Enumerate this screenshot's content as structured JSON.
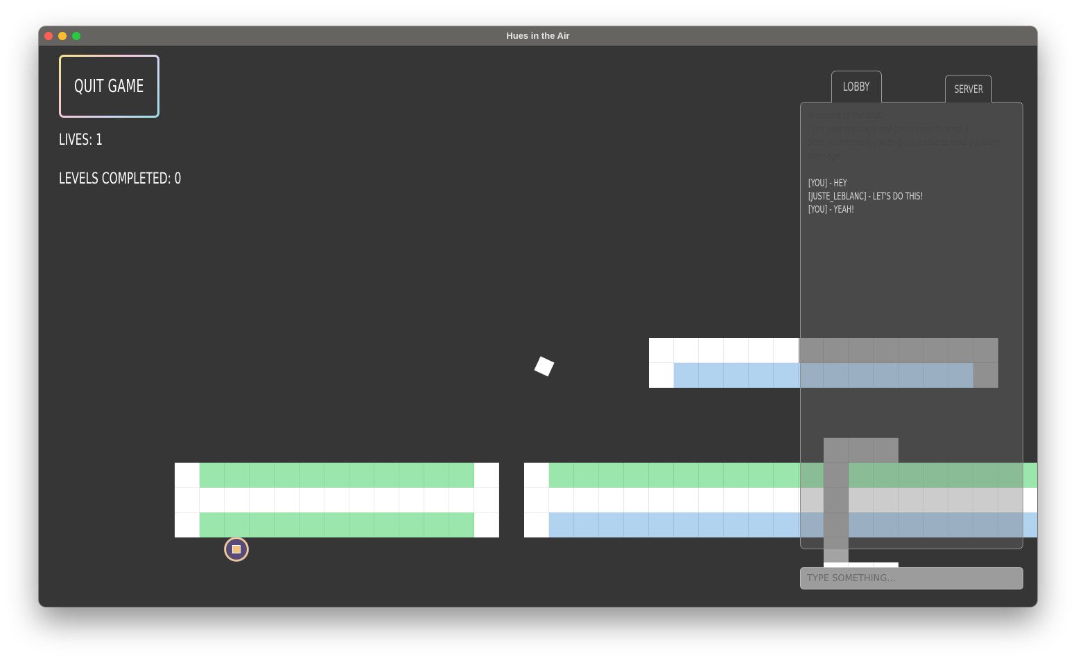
{
  "window": {
    "title": "Hues in the Air",
    "controls": [
      "close",
      "minimize",
      "zoom"
    ]
  },
  "hud": {
    "quit_label": "QUIT GAME",
    "lives_text": "LIVES: 1",
    "levels_text": "LEVELS COMPLETED: 0"
  },
  "chat": {
    "tabs": [
      {
        "label": "LOBBY",
        "active": true
      },
      {
        "label": "SERVER",
        "active": false
      }
    ],
    "help_lines": [
      "Welcome to the chat!",
      "Type your message and press enter to send it.",
      "Start your message with @username to send a private",
      "message."
    ],
    "messages": [
      "[YOU] - HEY",
      "[JUSTE_LEBLANC] - LET'S DO THIS!",
      "[YOU] - YEAH!"
    ],
    "input_placeholder": "TYPE SOMETHING..."
  },
  "colors": {
    "background": "#363636",
    "white_tile": "#ffffff",
    "green_tile": "#9ae6ad",
    "blue_tile": "#b2d3ef",
    "gray_tile": "#a3a3a3"
  },
  "icons": {
    "player": "player-ball-icon",
    "cube": "white-cube-icon"
  },
  "level": {
    "platform_1": [
      "WGGGGGGGGGGGW",
      "WWWWWWWWWWWWW",
      "WGGGGGGGGGGGW"
    ],
    "platform_2": [
      "WGGGGGGGGGGGGGGGGGGGG",
      "WWWWWWWWWWWWWWWWWWWWW",
      "WBBBBBBBBBBBBBBBBBBBB"
    ],
    "platform_3": [
      "WWWWWWRRRRRRRR",
      "WBBBBBBBBBBBBR"
    ],
    "pillar": [
      "RRR",
      "REE",
      "REE",
      "REE",
      "REE",
      "WWW"
    ]
  }
}
